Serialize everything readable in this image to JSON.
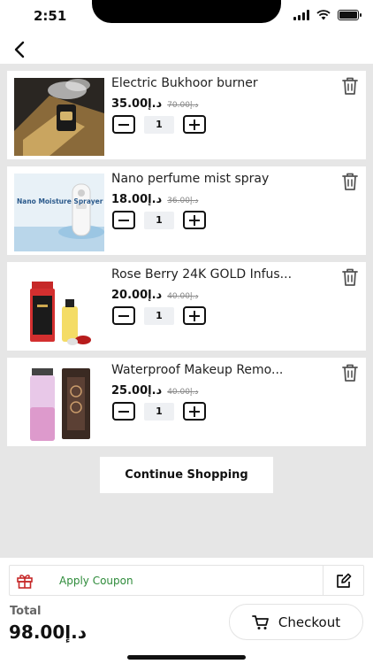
{
  "status_bar": {
    "time": "2:51"
  },
  "cart": {
    "items": [
      {
        "title": "Electric Bukhoor burner",
        "price": "35.00د.إ",
        "old_price": "70.00د.إ",
        "quantity": "1"
      },
      {
        "title": "Nano perfume mist spray",
        "price": "18.00د.إ",
        "old_price": "36.00د.إ",
        "quantity": "1",
        "image_text": "Nano Moisture Sprayer"
      },
      {
        "title": "Rose Berry 24K GOLD Infus...",
        "price": "20.00د.إ",
        "old_price": "40.00د.إ",
        "quantity": "1"
      },
      {
        "title": "Waterproof Makeup Remo...",
        "price": "25.00د.إ",
        "old_price": "40.00د.إ",
        "quantity": "1"
      }
    ],
    "continue_label": "Continue Shopping"
  },
  "footer": {
    "coupon_label": "Apply Coupon",
    "total_label": "Total",
    "total_value": "98.00د.إ",
    "checkout_label": "Checkout"
  },
  "colors": {
    "accent_red": "#c62828",
    "coupon_green": "#2e8b3a",
    "background": "#e6e6e6"
  }
}
